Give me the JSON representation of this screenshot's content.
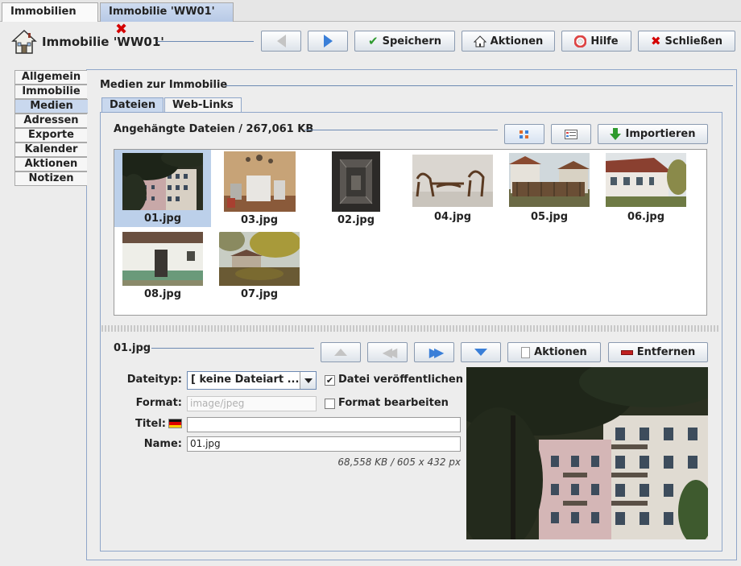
{
  "tabs": [
    {
      "label": "Immobilien"
    },
    {
      "label": "Immobilie 'WW01'"
    }
  ],
  "header": {
    "title": "Immobilie 'WW01'",
    "buttons": {
      "save": "Speichern",
      "actions": "Aktionen",
      "help": "Hilfe",
      "close": "Schließen"
    }
  },
  "sidebar": {
    "items": [
      {
        "label": "Allgemein"
      },
      {
        "label": "Immobilie"
      },
      {
        "label": "Medien"
      },
      {
        "label": "Adressen"
      },
      {
        "label": "Exporte"
      },
      {
        "label": "Kalender"
      },
      {
        "label": "Aktionen"
      },
      {
        "label": "Notizen"
      }
    ],
    "selected": "Medien"
  },
  "media": {
    "section_title": "Medien zur Immobilie",
    "subtabs": [
      {
        "label": "Dateien"
      },
      {
        "label": "Web-Links"
      }
    ],
    "attached_title": "Angehängte Dateien / 267,061 KB",
    "import_label": "Importieren",
    "files": [
      {
        "name": "01.jpg"
      },
      {
        "name": "03.jpg"
      },
      {
        "name": "02.jpg"
      },
      {
        "name": "04.jpg"
      },
      {
        "name": "05.jpg"
      },
      {
        "name": "06.jpg"
      },
      {
        "name": "08.jpg"
      },
      {
        "name": "07.jpg"
      }
    ],
    "selected_file": "01.jpg"
  },
  "detail": {
    "file_title": "01.jpg",
    "actions_label": "Aktionen",
    "remove_label": "Entfernen",
    "filetype_label": "Dateityp:",
    "filetype_value": "[ keine Dateiart ...",
    "publish_label": "Datei veröffentlichen",
    "publish_checked": true,
    "format_label": "Format:",
    "format_value": "image/jpeg",
    "edit_format_label": "Format bearbeiten",
    "edit_format_checked": false,
    "title_label": "Titel:",
    "title_value": "",
    "name_label": "Name:",
    "name_value": "01.jpg",
    "file_info": "68,558 KB / 605 x 432 px"
  },
  "colors": {
    "accent": "#6d8ab3",
    "selected_tab": "#c9d8ee",
    "close_red": "#d40000",
    "confirm_green": "#2e9a2e",
    "nav_blue": "#3a7fd8"
  }
}
